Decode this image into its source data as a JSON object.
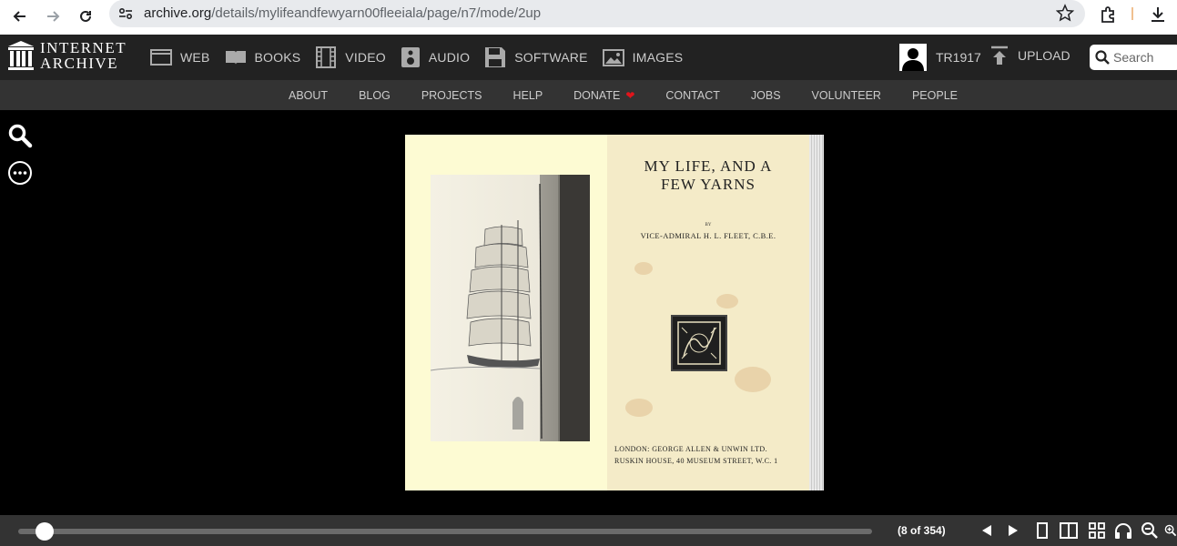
{
  "browser": {
    "url_host": "archive.org",
    "url_path": "/details/mylifeandfewyarn00fleeiala/page/n7/mode/2up"
  },
  "site": {
    "logo_line1": "INTERNET",
    "logo_line2": "ARCHIVE",
    "media_links": [
      {
        "label": "WEB",
        "icon": "web-icon"
      },
      {
        "label": "BOOKS",
        "icon": "books-icon"
      },
      {
        "label": "VIDEO",
        "icon": "film-icon"
      },
      {
        "label": "AUDIO",
        "icon": "speaker-icon"
      },
      {
        "label": "SOFTWARE",
        "icon": "floppy-icon"
      },
      {
        "label": "IMAGES",
        "icon": "image-icon"
      }
    ],
    "username": "TR1917",
    "upload_label": "UPLOAD",
    "search_placeholder": "Search",
    "subnav": [
      "ABOUT",
      "BLOG",
      "PROJECTS",
      "HELP",
      "DONATE",
      "CONTACT",
      "JOBS",
      "VOLUNTEER",
      "PEOPLE"
    ],
    "heart_color": "#e0141b"
  },
  "book": {
    "title_line1": "MY LIFE, AND A",
    "title_line2": "FEW YARNS",
    "by": "BY",
    "author": "VICE-ADMIRAL H. L. FLEET, C.B.E.",
    "publisher_line1": "LONDON: GEORGE ALLEN & UNWIN LTD.",
    "publisher_line2": "RUSKIN HOUSE, 40 MUSEUM STREET, W.C. 1"
  },
  "viewer": {
    "page_indicator": "(8 of 354)",
    "progress_fraction": 0.02
  }
}
